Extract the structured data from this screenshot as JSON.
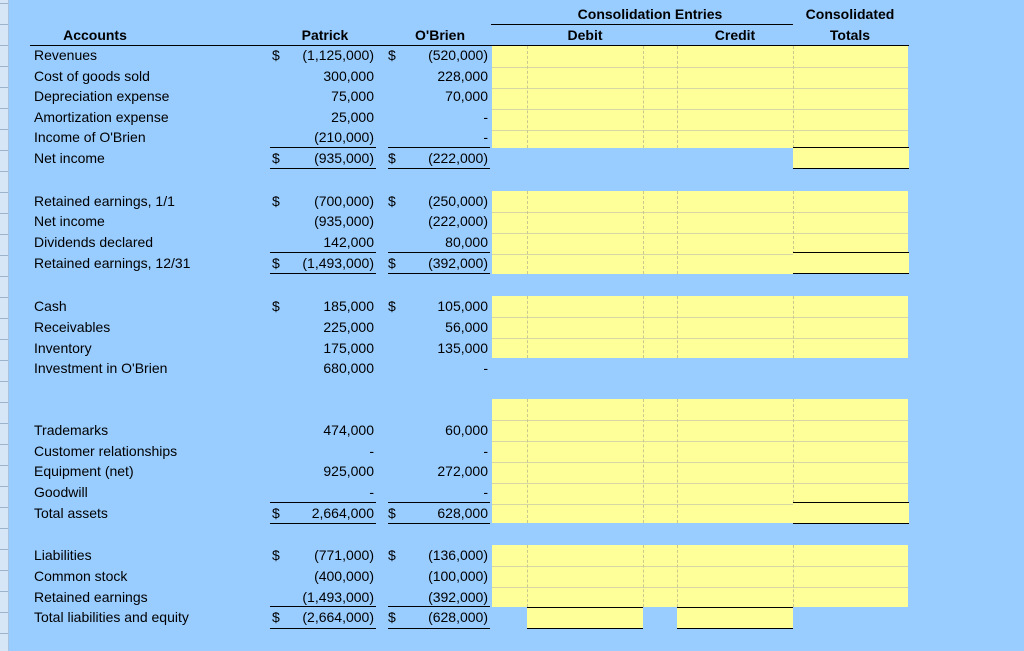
{
  "headers": {
    "accounts": "Accounts",
    "patrick": "Patrick",
    "obrien": "O'Brien",
    "consolidation_entries": "Consolidation Entries",
    "debit": "Debit",
    "credit": "Credit",
    "consolidated": "Consolidated",
    "totals": "Totals"
  },
  "rows": [
    {
      "label": "Revenues",
      "p_sign": "$",
      "p_val": "(1,125,000)",
      "o_sign": "$",
      "o_val": "(520,000)"
    },
    {
      "label": "Cost of goods sold",
      "p_sign": "",
      "p_val": "300,000",
      "o_sign": "",
      "o_val": "228,000"
    },
    {
      "label": "Depreciation expense",
      "p_sign": "",
      "p_val": "75,000",
      "o_sign": "",
      "o_val": "70,000"
    },
    {
      "label": "Amortization expense",
      "p_sign": "",
      "p_val": "25,000",
      "o_sign": "",
      "o_val": "-"
    },
    {
      "label": "Income of O'Brien",
      "p_sign": "",
      "p_val": "(210,000)",
      "o_sign": "",
      "o_val": "-"
    },
    {
      "label": "Net income",
      "p_sign": "$",
      "p_val": "(935,000)",
      "o_sign": "$",
      "o_val": "(222,000)"
    },
    {
      "label": "Retained earnings, 1/1",
      "p_sign": "$",
      "p_val": "(700,000)",
      "o_sign": "$",
      "o_val": "(250,000)"
    },
    {
      "label": "Net income",
      "p_sign": "",
      "p_val": "(935,000)",
      "o_sign": "",
      "o_val": "(222,000)"
    },
    {
      "label": "Dividends declared",
      "p_sign": "",
      "p_val": "142,000",
      "o_sign": "",
      "o_val": "80,000"
    },
    {
      "label": "Retained earnings, 12/31",
      "p_sign": "$",
      "p_val": "(1,493,000)",
      "o_sign": "$",
      "o_val": "(392,000)"
    },
    {
      "label": "Cash",
      "p_sign": "$",
      "p_val": "185,000",
      "o_sign": "$",
      "o_val": "105,000"
    },
    {
      "label": "Receivables",
      "p_sign": "",
      "p_val": "225,000",
      "o_sign": "",
      "o_val": "56,000"
    },
    {
      "label": "Inventory",
      "p_sign": "",
      "p_val": "175,000",
      "o_sign": "",
      "o_val": "135,000"
    },
    {
      "label": "Investment in O'Brien",
      "p_sign": "",
      "p_val": "680,000",
      "o_sign": "",
      "o_val": "-"
    },
    {
      "label": "Trademarks",
      "p_sign": "",
      "p_val": "474,000",
      "o_sign": "",
      "o_val": "60,000"
    },
    {
      "label": "Customer relationships",
      "p_sign": "",
      "p_val": "-",
      "o_sign": "",
      "o_val": "-"
    },
    {
      "label": "Equipment (net)",
      "p_sign": "",
      "p_val": "925,000",
      "o_sign": "",
      "o_val": "272,000"
    },
    {
      "label": "Goodwill",
      "p_sign": "",
      "p_val": "-",
      "o_sign": "",
      "o_val": "-"
    },
    {
      "label": "Total assets",
      "p_sign": "$",
      "p_val": "2,664,000",
      "o_sign": "$",
      "o_val": "628,000"
    },
    {
      "label": "Liabilities",
      "p_sign": "$",
      "p_val": "(771,000)",
      "o_sign": "$",
      "o_val": "(136,000)"
    },
    {
      "label": "Common stock",
      "p_sign": "",
      "p_val": "(400,000)",
      "o_sign": "",
      "o_val": "(100,000)"
    },
    {
      "label": "Retained earnings",
      "p_sign": "",
      "p_val": "(1,493,000)",
      "o_sign": "",
      "o_val": "(392,000)"
    },
    {
      "label": "Total liabilities and equity",
      "p_sign": "$",
      "p_val": "(2,664,000)",
      "o_sign": "$",
      "o_val": "(628,000)"
    }
  ]
}
